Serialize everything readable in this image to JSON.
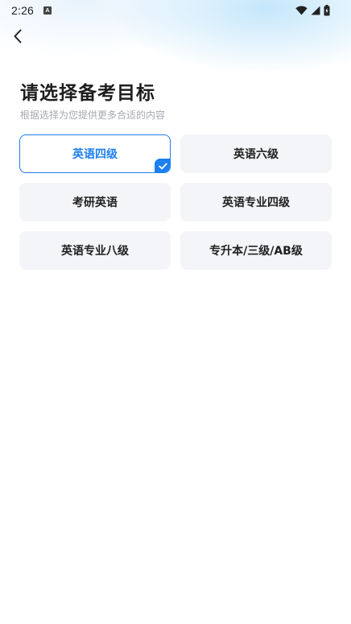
{
  "status_bar": {
    "time": "2:26",
    "app_icon_letter": "A",
    "icons": [
      "wifi-icon",
      "signal-icon",
      "battery-charging-icon"
    ]
  },
  "header": {
    "back_icon": "chevron-left-icon",
    "title": "请选择备考目标",
    "subtitle": "根据选择为您提供更多合适的内容"
  },
  "options": [
    {
      "label": "英语四级",
      "selected": true
    },
    {
      "label": "英语六级",
      "selected": false
    },
    {
      "label": "考研英语",
      "selected": false
    },
    {
      "label": "英语专业四级",
      "selected": false
    },
    {
      "label": "英语专业八级",
      "selected": false
    },
    {
      "label": "专升本/三级/AB级",
      "selected": false
    }
  ],
  "colors": {
    "accent": "#1d7ff0",
    "option_bg": "#f4f5f8",
    "title": "#1d1d1f",
    "subtitle": "#a7a9b0"
  }
}
